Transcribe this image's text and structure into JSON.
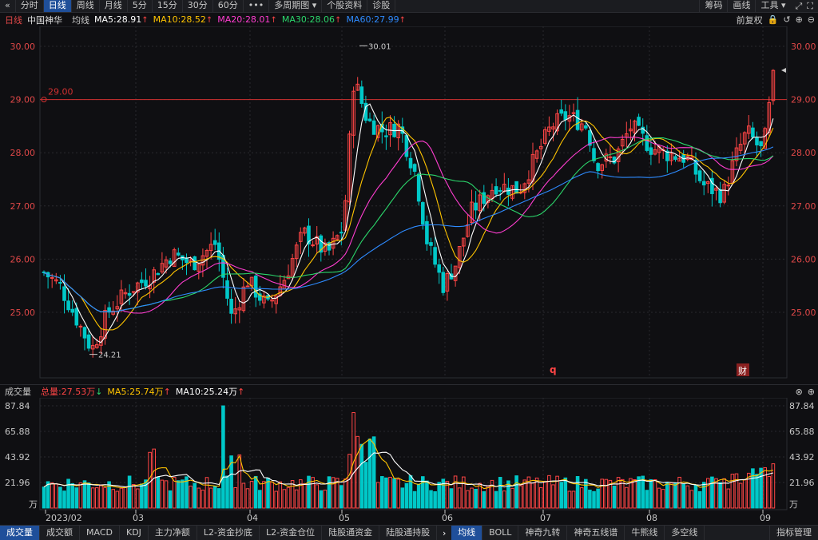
{
  "toolbar": {
    "back_icon": "back-icon",
    "tabs": [
      "分时",
      "日线",
      "周线",
      "月线",
      "5分",
      "15分",
      "30分",
      "60分",
      "•••",
      "多周期图 ▾",
      "个股资料",
      "诊股"
    ],
    "right_items": [
      "筹码",
      "画线",
      "工具 ▾"
    ]
  },
  "ma_bar": {
    "period": "日线",
    "stock_name": "中国神华",
    "avg_line": "均线",
    "ma5": "MA5:28.91",
    "ma10": "MA10:28.52",
    "ma20": "MA20:28.01",
    "ma30": "MA30:28.06",
    "ma60": "MA60:27.99",
    "fuquan": "前复权"
  },
  "colors": {
    "up": "#ff4545",
    "down": "#00c8c8",
    "ma5": "#ffffff",
    "ma10": "#ffc400",
    "ma20": "#ff3dd0",
    "ma30": "#2bd66b",
    "ma60": "#2e8bff",
    "grid": "#2a2a2e",
    "axis_text": "#e04848",
    "vol_axis_text": "#c8c8c8",
    "active_tab": "#1f4f9a"
  },
  "price_axis": {
    "ticks": [
      "30.00",
      "29.00",
      "28.00",
      "27.00",
      "26.00",
      "25.00"
    ],
    "horizontal_line_label": "29.00",
    "high_label": "30.01",
    "low_label": "24.21",
    "event_markers": [
      "q",
      "财"
    ]
  },
  "volume_header": {
    "title": "成交量",
    "total": "总量:27.53万",
    "ma5": "MA5:25.74万",
    "ma10": "MA10:25.24万"
  },
  "volume_axis": {
    "ticks": [
      "87.84",
      "65.88",
      "43.92",
      "21.96"
    ],
    "unit": "万"
  },
  "date_axis": [
    "2023/02",
    "03",
    "04",
    "05",
    "06",
    "07",
    "08",
    "09"
  ],
  "bottom_tabs_left": [
    "成交量",
    "成交额",
    "MACD",
    "KDJ",
    "主力净额",
    "L2-资金抄底",
    "L2-资金仓位",
    "陆股通资金",
    "陆股通持股"
  ],
  "bottom_tabs_right": [
    "均线",
    "BOLL",
    "神奇九转",
    "神奇五线谱",
    "牛熊线",
    "多空线"
  ],
  "bottom_right_label": "指标管理",
  "chart_data": {
    "type": "candlestick",
    "price_range": [
      24.21,
      30.01
    ],
    "price_close_key": [
      {
        "x": "2023/02",
        "y": 25.7
      },
      {
        "x": "02-low",
        "y": 24.3
      },
      {
        "x": "03",
        "y": 25.6
      },
      {
        "x": "04",
        "y": 25.2
      },
      {
        "x": "05",
        "y": 29.4
      },
      {
        "x": "06",
        "y": 25.6
      },
      {
        "x": "07",
        "y": 28.6
      },
      {
        "x": "08",
        "y": 28.0
      },
      {
        "x": "09",
        "y": 29.4
      }
    ],
    "volume_range": [
      0,
      87.84
    ]
  }
}
